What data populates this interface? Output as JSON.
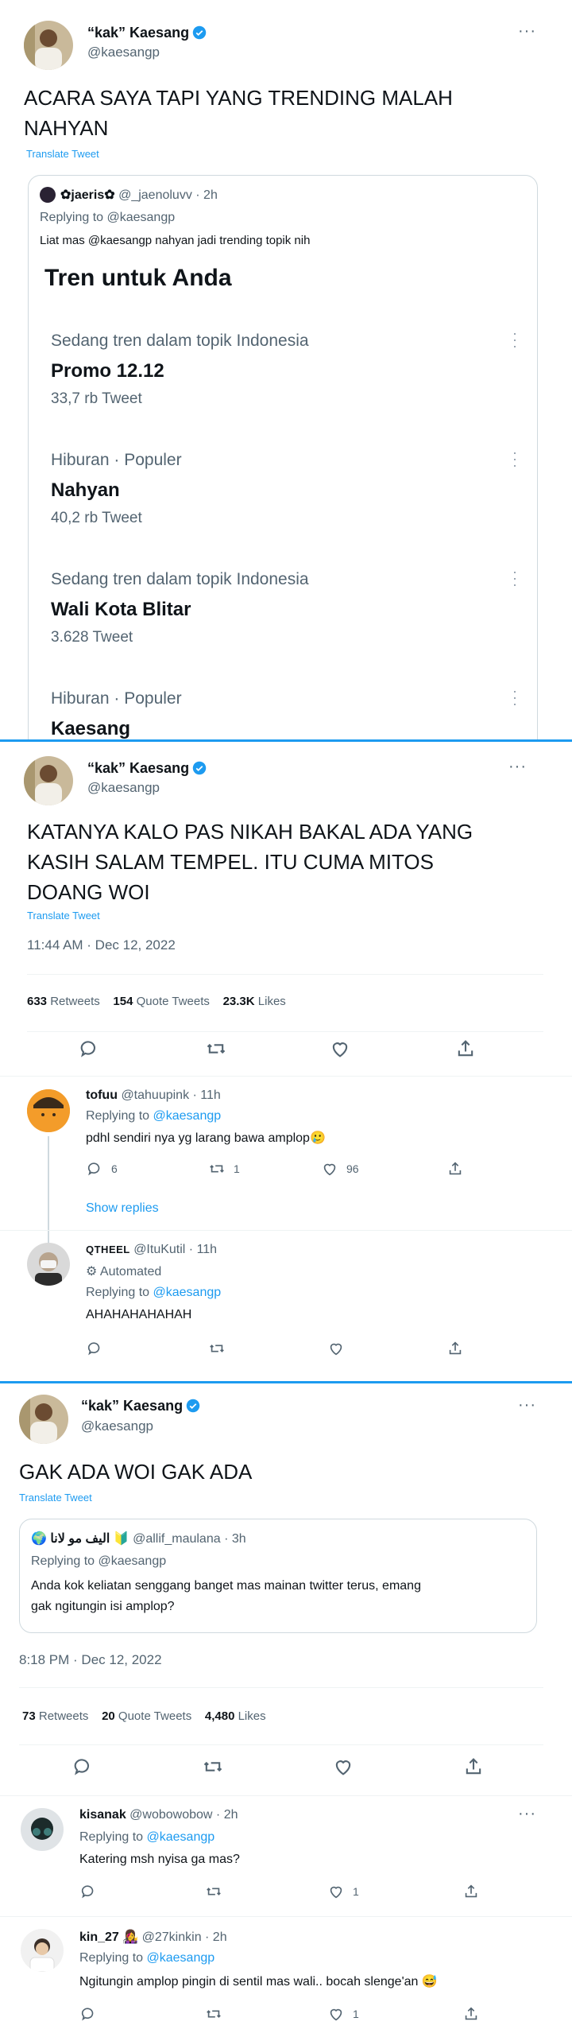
{
  "colors": {
    "accent": "#1d9bf0",
    "text": "#0f1419",
    "muted": "#536471",
    "border": "#cfd9de"
  },
  "tweet1": {
    "author": {
      "name": "“kak” Kaesang",
      "handle": "@kaesangp"
    },
    "more_icon": "···",
    "text_line1": "ACARA SAYA TAPI YANG TRENDING MALAH",
    "text_line2": "NAHYAN",
    "translate": "Translate Tweet",
    "quote": {
      "name": "✿jaeris✿",
      "handle_time": "@_jaenoluvv · 2h",
      "replying": "Replying to @kaesangp",
      "text": "Liat mas @kaesangp nahyan jadi trending topik nih",
      "trends_title": "Tren untuk Anda",
      "trends": [
        {
          "category": "Sedang tren dalam topik Indonesia",
          "title": "Promo 12.12",
          "count": "33,7 rb Tweet"
        },
        {
          "category": "Hiburan · Populer",
          "title": "Nahyan",
          "count": "40,2 rb Tweet"
        },
        {
          "category": "Sedang tren dalam topik Indonesia",
          "title": "Wali Kota Blitar",
          "count": "3.628 Tweet"
        },
        {
          "category": "Hiburan · Populer",
          "title": "Kaesang",
          "count": ""
        }
      ]
    }
  },
  "tweet2": {
    "author": {
      "name": "“kak” Kaesang",
      "handle": "@kaesangp"
    },
    "more_icon": "···",
    "text_line1": "KATANYA KALO PAS NIKAH BAKAL ADA YANG",
    "text_line2": "KASIH SALAM TEMPEL. ITU CUMA MITOS",
    "text_line3": "DOANG WOI",
    "translate": "Translate Tweet",
    "timestamp": "11:44 AM · Dec 12, 2022",
    "retweets_num": "633",
    "retweets_label": "Retweets",
    "quotes_num": "154",
    "quotes_label": "Quote Tweets",
    "likes_num": "23.3K",
    "likes_label": "Likes",
    "replies": [
      {
        "name": "tofuu",
        "handle_time": "@tahuupink · 11h",
        "replying_prefix": "Replying to ",
        "replying_user": "@kaesangp",
        "text": "pdhl sendiri nya yg larang bawa amplop🥲",
        "reply_count": "6",
        "retweet_count": "1",
        "like_count": "96",
        "show_replies": "Show replies"
      },
      {
        "name": "QTHEEL",
        "handle_time": "@ItuKutil · 11h",
        "automated": "Automated",
        "replying_prefix": "Replying to ",
        "replying_user": "@kaesangp",
        "text": "AHAHAHAHAHAH"
      }
    ]
  },
  "tweet3": {
    "author": {
      "name": "“kak” Kaesang",
      "handle": "@kaesangp"
    },
    "more_icon": "···",
    "text": "GAK ADA WOI GAK ADA",
    "translate": "Translate Tweet",
    "quote": {
      "name": "🌍 اليف مو لانا 🔰",
      "handle_time": "@allif_maulana · 3h",
      "replying": "Replying to @kaesangp",
      "text_line1": "Anda kok keliatan senggang banget mas mainan twitter terus, emang",
      "text_line2": "gak ngitungin isi amplop?"
    },
    "timestamp": "8:18 PM · Dec 12, 2022",
    "retweets_num": "73",
    "retweets_label": "Retweets",
    "quotes_num": "20",
    "quotes_label": "Quote Tweets",
    "likes_num": "4,480",
    "likes_label": "Likes",
    "replies": [
      {
        "name": "kisanak",
        "handle_time": "@wobowobow · 2h",
        "replying_prefix": "Replying to ",
        "replying_user": "@kaesangp",
        "text": "Katering msh nyisa ga mas?",
        "like_count": "1"
      },
      {
        "name": "kin_27 👩‍🎤",
        "handle_time": "@27kinkin · 2h",
        "replying_prefix": "Replying to ",
        "replying_user": "@kaesangp",
        "text": "Ngitungin amplop pingin di sentil mas wali.. bocah slenge'an 😅",
        "like_count": "1"
      }
    ]
  }
}
